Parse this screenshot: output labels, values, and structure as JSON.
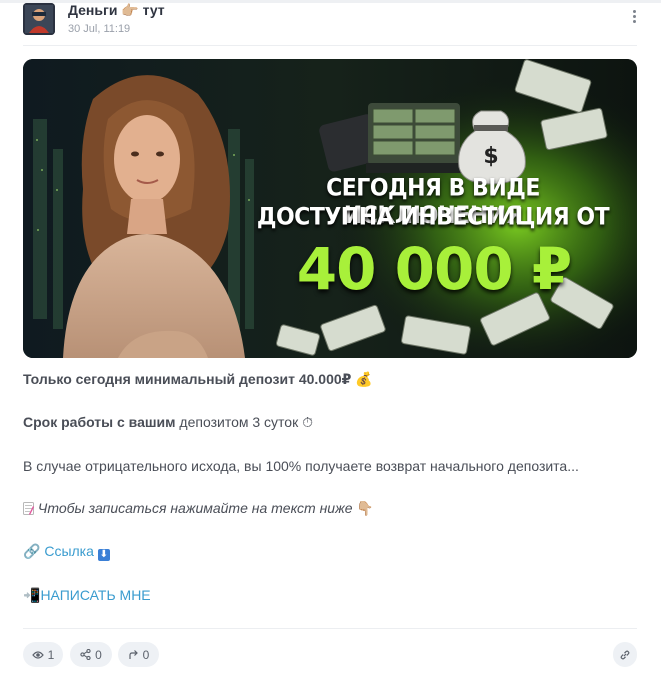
{
  "header": {
    "channel_name": "Деньги 👉🏼 тут",
    "date": "30 Jul, 11:19"
  },
  "banner": {
    "headline_line1": "СЕГОДНЯ В ВИДЕ ИСКЛЮЧЕНИЯ",
    "headline_line2": "ДОСТУПНА ИНВЕСТИЦИЯ ОТ",
    "amount": "40 000 ₽",
    "bag_symbol": "$",
    "accent_color": "#a8f03a"
  },
  "post": {
    "line1": "Только сегодня минимальный депозит 40.000₽",
    "line1_emoji": "💰",
    "line2_bold": "Срок работы с вашим",
    "line2_rest": " депозитом 3 суток",
    "line2_emoji": "⏱",
    "line3": "В случае отрицательного исхода, вы 100% получаете возврат начального депозита...",
    "line4": "Чтобы записаться нажимайте на текст ниже",
    "line4_emoji": "👇🏼",
    "link_emoji": "🔗",
    "link_label": "Ссылка",
    "link_arrow": "⬇",
    "write_emoji": "📲",
    "write_label": "НАПИСАТЬ МНЕ",
    "link_color": "#3a9ccf"
  },
  "footer": {
    "views": "1",
    "shares": "0",
    "forwards": "0"
  }
}
